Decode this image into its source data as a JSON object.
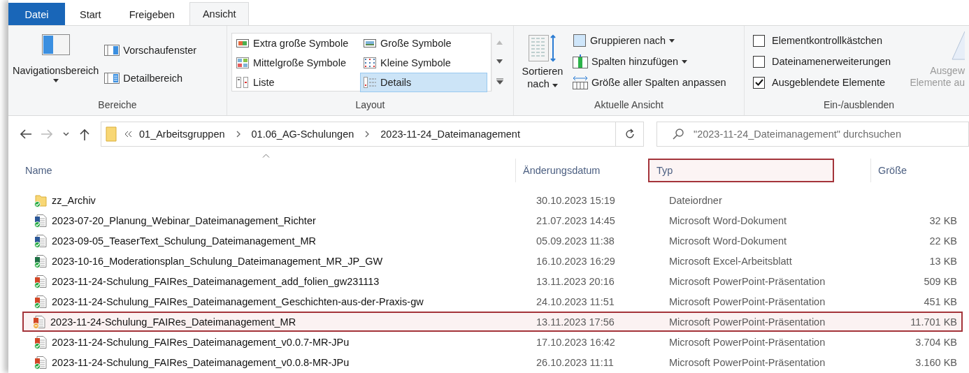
{
  "ribbon_tabs": [
    {
      "label": "Datei",
      "kind": "file",
      "selected": false
    },
    {
      "label": "Start",
      "kind": "tab",
      "selected": false
    },
    {
      "label": "Freigeben",
      "kind": "tab",
      "selected": false
    },
    {
      "label": "Ansicht",
      "kind": "tab",
      "selected": true
    }
  ],
  "panes": {
    "navigation": "Navigationsbereich",
    "preview": "Vorschaufenster",
    "details": "Detailbereich",
    "group_label": "Bereiche"
  },
  "layout": {
    "group_label": "Layout",
    "options": [
      {
        "label": "Extra große Symbole",
        "kind": "xl",
        "selected": false
      },
      {
        "label": "Große Symbole",
        "kind": "large",
        "selected": false
      },
      {
        "label": "Mittelgroße Symbole",
        "kind": "medium",
        "selected": false
      },
      {
        "label": "Kleine Symbole",
        "kind": "small",
        "selected": false
      },
      {
        "label": "Liste",
        "kind": "list",
        "selected": false
      },
      {
        "label": "Details",
        "kind": "details",
        "selected": true
      }
    ]
  },
  "current_view": {
    "sort": "Sortieren nach",
    "group_label": "Aktuelle Ansicht",
    "commands": [
      {
        "label": "Gruppieren nach",
        "kind": "group",
        "dropdown": true
      },
      {
        "label": "Spalten hinzufügen",
        "kind": "columns",
        "dropdown": true
      },
      {
        "label": "Größe aller Spalten anpassen",
        "kind": "fit",
        "dropdown": false
      }
    ]
  },
  "show_hide": {
    "group_label": "Ein-/ausblenden",
    "options": [
      {
        "label": "Elementkontrollkästchen",
        "checked": false
      },
      {
        "label": "Dateinamenerweiterungen",
        "checked": false
      },
      {
        "label": "Ausgeblendete Elemente",
        "checked": true
      }
    ],
    "hide_selected": {
      "lines": [
        "Ausgew",
        "Elemente au"
      ],
      "disabled": true
    }
  },
  "address": {
    "crumbs": [
      "01_Arbeitsgruppen",
      "01.06_AG-Schulungen",
      "2023-11-24_Dateimanagement"
    ],
    "search_placeholder": "\"2023-11-24_Dateimanagement\" durchsuchen"
  },
  "table": {
    "columns": [
      {
        "label": "Name",
        "highlighted": false,
        "sorted": true
      },
      {
        "label": "Änderungsdatum",
        "highlighted": false,
        "sorted": false
      },
      {
        "label": "Typ",
        "highlighted": true,
        "sorted": false
      },
      {
        "label": "Größe",
        "highlighted": false,
        "sorted": false
      }
    ],
    "rows": [
      {
        "name": "zz_Archiv",
        "date": "30.10.2023 15:19",
        "type": "Dateiordner",
        "kind": "folder",
        "synced": true,
        "highlighted": false
      },
      {
        "name": "2023-07-20_Planung_Webinar_Dateimanagement_Richter",
        "date": "21.07.2023 14:45",
        "type": "Microsoft Word-Dokument",
        "size": "32 KB",
        "kind": "word",
        "synced": true,
        "highlighted": false
      },
      {
        "name": "2023-09-05_TeaserText_Schulung_Dateimanagement_MR",
        "date": "05.09.2023 11:38",
        "type": "Microsoft Word-Dokument",
        "size": "22 KB",
        "kind": "word",
        "synced": true,
        "highlighted": false
      },
      {
        "name": "2023-10-16_Moderationsplan_Schulung_Dateimanagement_MR_JP_GW",
        "date": "16.10.2023 16:29",
        "type": "Microsoft Excel-Arbeitsblatt",
        "size": "13 KB",
        "kind": "excel",
        "synced": true,
        "highlighted": false
      },
      {
        "name": "2023-11-24-Schulung_FAIRes_Dateimanagement_add_folien_gw231113",
        "date": "13.11.2023 20:16",
        "type": "Microsoft PowerPoint-Präsentation",
        "size": "509 KB",
        "kind": "powerpoint",
        "synced": true,
        "highlighted": false
      },
      {
        "name": "2023-11-24-Schulung_FAIRes_Dateimanagement_Geschichten-aus-der-Praxis-gw",
        "date": "24.10.2023 11:51",
        "type": "Microsoft PowerPoint-Präsentation",
        "size": "451 KB",
        "kind": "powerpoint",
        "synced": true,
        "highlighted": false
      },
      {
        "name": "2023-11-24-Schulung_FAIRes_Dateimanagement_MR",
        "date": "13.11.2023 17:56",
        "type": "Microsoft PowerPoint-Präsentation",
        "size": "11.701 KB",
        "kind": "powerpoint",
        "synced": false,
        "highlighted": true
      },
      {
        "name": "2023-11-24-Schulung_FAIRes_Dateimanagement_v0.0.7-MR-JPu",
        "date": "17.10.2023 16:42",
        "type": "Microsoft PowerPoint-Präsentation",
        "size": "3.704 KB",
        "kind": "powerpoint",
        "synced": true,
        "highlighted": false
      },
      {
        "name": "2023-11-24-Schulung_FAIRes_Dateimanagement_v0.0.8-MR-JPu",
        "date": "26.10.2023 11:11",
        "type": "Microsoft PowerPoint-Präsentation",
        "size": "3.160 KB",
        "kind": "powerpoint",
        "synced": true,
        "highlighted": false
      }
    ]
  }
}
